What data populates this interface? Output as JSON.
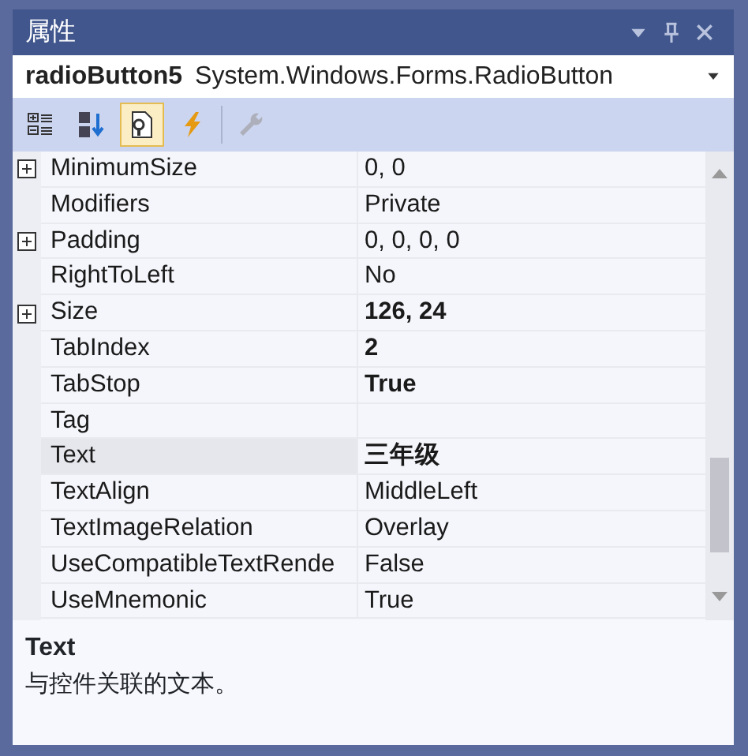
{
  "window": {
    "title": "属性",
    "buttons": [
      {
        "kind": "dropdown"
      },
      {
        "kind": "pin"
      },
      {
        "kind": "close"
      }
    ]
  },
  "object_selector": {
    "name": "radioButton5",
    "type": "System.Windows.Forms.RadioButton"
  },
  "toolbar": [
    {
      "kind": "categorized",
      "selected": false,
      "disabled": false
    },
    {
      "kind": "alphabetical",
      "selected": false,
      "disabled": false
    },
    {
      "kind": "properties",
      "selected": true,
      "disabled": false
    },
    {
      "kind": "events",
      "selected": false,
      "disabled": false
    },
    {
      "kind": "property_pages",
      "selected": false,
      "disabled": true
    }
  ],
  "properties": [
    {
      "name": "MinimumSize",
      "value": "0, 0",
      "expandable": true,
      "modified": false,
      "selected": false
    },
    {
      "name": "Modifiers",
      "value": "Private",
      "expandable": false,
      "modified": false,
      "selected": false
    },
    {
      "name": "Padding",
      "value": "0, 0, 0, 0",
      "expandable": true,
      "modified": false,
      "selected": false
    },
    {
      "name": "RightToLeft",
      "value": "No",
      "expandable": false,
      "modified": false,
      "selected": false
    },
    {
      "name": "Size",
      "value": "126, 24",
      "expandable": true,
      "modified": true,
      "selected": false
    },
    {
      "name": "TabIndex",
      "value": "2",
      "expandable": false,
      "modified": true,
      "selected": false
    },
    {
      "name": "TabStop",
      "value": "True",
      "expandable": false,
      "modified": true,
      "selected": false
    },
    {
      "name": "Tag",
      "expandable": false,
      "selected": false
    },
    {
      "name": "Text",
      "value": "三年级",
      "expandable": false,
      "modified": true,
      "selected": true
    },
    {
      "name": "TextAlign",
      "value": "MiddleLeft",
      "expandable": false,
      "modified": false,
      "selected": false
    },
    {
      "name": "TextImageRelation",
      "value": "Overlay",
      "expandable": false,
      "modified": false,
      "selected": false
    },
    {
      "name": "UseCompatibleTextRende",
      "value": "False",
      "expandable": false,
      "modified": false,
      "selected": false
    },
    {
      "name": "UseMnemonic",
      "value": "True",
      "expandable": false,
      "modified": false,
      "selected": false
    }
  ],
  "description": {
    "title": "Text",
    "text": "与控件关联的文本。"
  }
}
